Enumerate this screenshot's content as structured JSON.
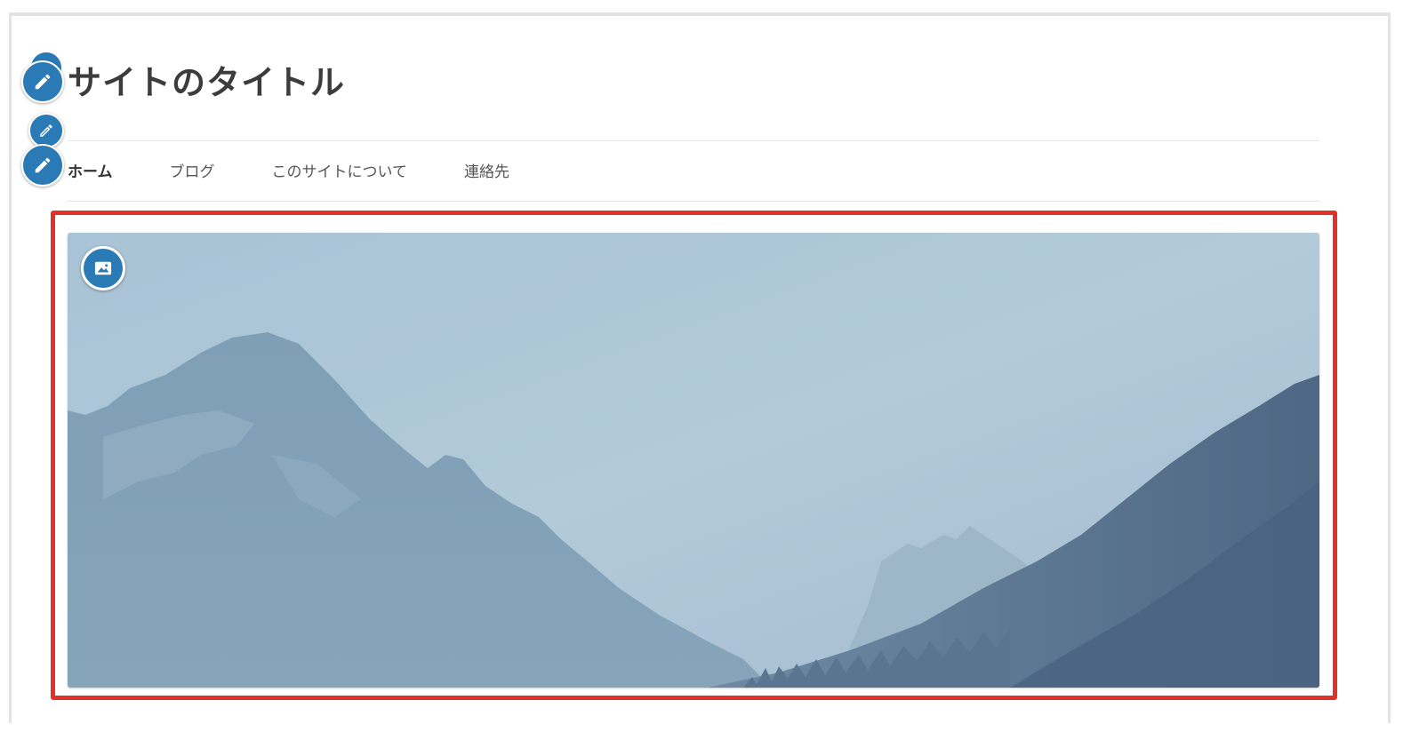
{
  "site": {
    "title": "サイトのタイトル"
  },
  "nav": {
    "items": [
      {
        "label": "ホーム",
        "active": true
      },
      {
        "label": "ブログ",
        "active": false
      },
      {
        "label": "このサイトについて",
        "active": false
      },
      {
        "label": "連絡先",
        "active": false
      }
    ]
  },
  "icons": {
    "edit_title": "pencil-icon",
    "edit_line": "pencil-icon",
    "edit_nav": "pencil-icon",
    "hero_image": "image-icon"
  },
  "colors": {
    "accent": "#2a7ab5",
    "highlight": "#e0322b",
    "title_text": "#3c3c3c"
  }
}
